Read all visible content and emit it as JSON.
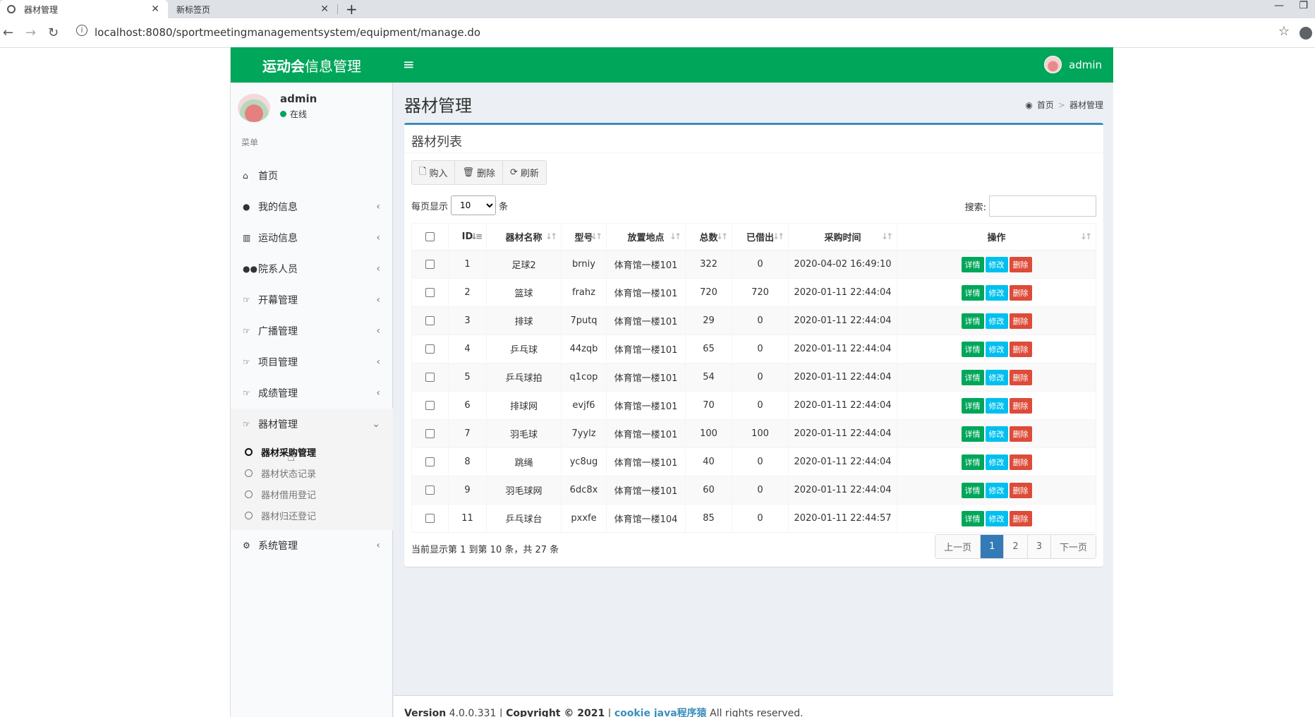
{
  "browser": {
    "tabs": [
      {
        "title": "器材管理",
        "active": true
      },
      {
        "title": "新标签页",
        "active": false
      }
    ],
    "url": "localhost:8080/sportmeetingmanagementsystem/equipment/manage.do"
  },
  "app": {
    "logo_bold": "运动会",
    "logo_rest": "信息管理",
    "top_user": "admin",
    "accent": "#00a65a"
  },
  "sidebar": {
    "username": "admin",
    "status": "在线",
    "header": "菜单",
    "items": [
      {
        "label": "首页",
        "icon": "home-icon"
      },
      {
        "label": "我的信息",
        "icon": "user-icon"
      },
      {
        "label": "运动信息",
        "icon": "bar-chart-icon"
      },
      {
        "label": "院系人员",
        "icon": "users-icon"
      },
      {
        "label": "开幕管理",
        "icon": "hand-point-icon"
      },
      {
        "label": "广播管理",
        "icon": "hand-point-icon"
      },
      {
        "label": "项目管理",
        "icon": "hand-point-icon"
      },
      {
        "label": "成绩管理",
        "icon": "hand-point-icon"
      },
      {
        "label": "器材管理",
        "icon": "hand-point-icon"
      },
      {
        "label": "系统管理",
        "icon": "gear-icon"
      }
    ],
    "submenu": [
      {
        "label": "器材采购管理",
        "active": true
      },
      {
        "label": "器材状态记录",
        "active": false
      },
      {
        "label": "器材借用登记",
        "active": false
      },
      {
        "label": "器材归还登记",
        "active": false
      }
    ]
  },
  "page": {
    "title": "器材管理",
    "breadcrumb_home": "首页",
    "breadcrumb_current": "器材管理",
    "box_title": "器材列表",
    "buttons": {
      "buy": "购入",
      "delete": "删除",
      "refresh": "刷新"
    },
    "length_prefix": "每页显示",
    "length_value": "10",
    "length_suffix": "条",
    "search_label": "搜索:",
    "columns": [
      "ID",
      "器材名称",
      "型号",
      "放置地点",
      "总数",
      "已借出",
      "采购时间",
      "操作"
    ],
    "rows": [
      {
        "id": "1",
        "name": "足球2",
        "model": "brniy",
        "location": "体育馆一楼101",
        "total": "322",
        "lent": "0",
        "time": "2020-04-02 16:49:10"
      },
      {
        "id": "2",
        "name": "篮球",
        "model": "frahz",
        "location": "体育馆一楼101",
        "total": "720",
        "lent": "720",
        "time": "2020-01-11 22:44:04"
      },
      {
        "id": "3",
        "name": "排球",
        "model": "7putq",
        "location": "体育馆一楼101",
        "total": "29",
        "lent": "0",
        "time": "2020-01-11 22:44:04"
      },
      {
        "id": "4",
        "name": "乒乓球",
        "model": "44zqb",
        "location": "体育馆一楼101",
        "total": "65",
        "lent": "0",
        "time": "2020-01-11 22:44:04"
      },
      {
        "id": "5",
        "name": "乒乓球拍",
        "model": "q1cop",
        "location": "体育馆一楼101",
        "total": "54",
        "lent": "0",
        "time": "2020-01-11 22:44:04"
      },
      {
        "id": "6",
        "name": "排球网",
        "model": "evjf6",
        "location": "体育馆一楼101",
        "total": "70",
        "lent": "0",
        "time": "2020-01-11 22:44:04"
      },
      {
        "id": "7",
        "name": "羽毛球",
        "model": "7yylz",
        "location": "体育馆一楼101",
        "total": "100",
        "lent": "100",
        "time": "2020-01-11 22:44:04"
      },
      {
        "id": "8",
        "name": "跳绳",
        "model": "yc8ug",
        "location": "体育馆一楼101",
        "total": "40",
        "lent": "0",
        "time": "2020-01-11 22:44:04"
      },
      {
        "id": "9",
        "name": "羽毛球网",
        "model": "6dc8x",
        "location": "体育馆一楼101",
        "total": "60",
        "lent": "0",
        "time": "2020-01-11 22:44:04"
      },
      {
        "id": "11",
        "name": "乒乓球台",
        "model": "pxxfe",
        "location": "体育馆一楼104",
        "total": "85",
        "lent": "0",
        "time": "2020-01-11 22:44:57"
      }
    ],
    "actions": {
      "detail": "详情",
      "edit": "修改",
      "del": "删除"
    },
    "info": "当前显示第 1 到第 10 条，共 27 条",
    "pager": {
      "prev": "上一页",
      "pages": [
        "1",
        "2",
        "3"
      ],
      "current": "1",
      "next": "下一页"
    }
  },
  "footer": {
    "version_label": "Version",
    "version": "4.0.0.331",
    "copyright": "Copyright © 2021",
    "link": "cookie java程序猿",
    "rights": "All rights reserved."
  }
}
